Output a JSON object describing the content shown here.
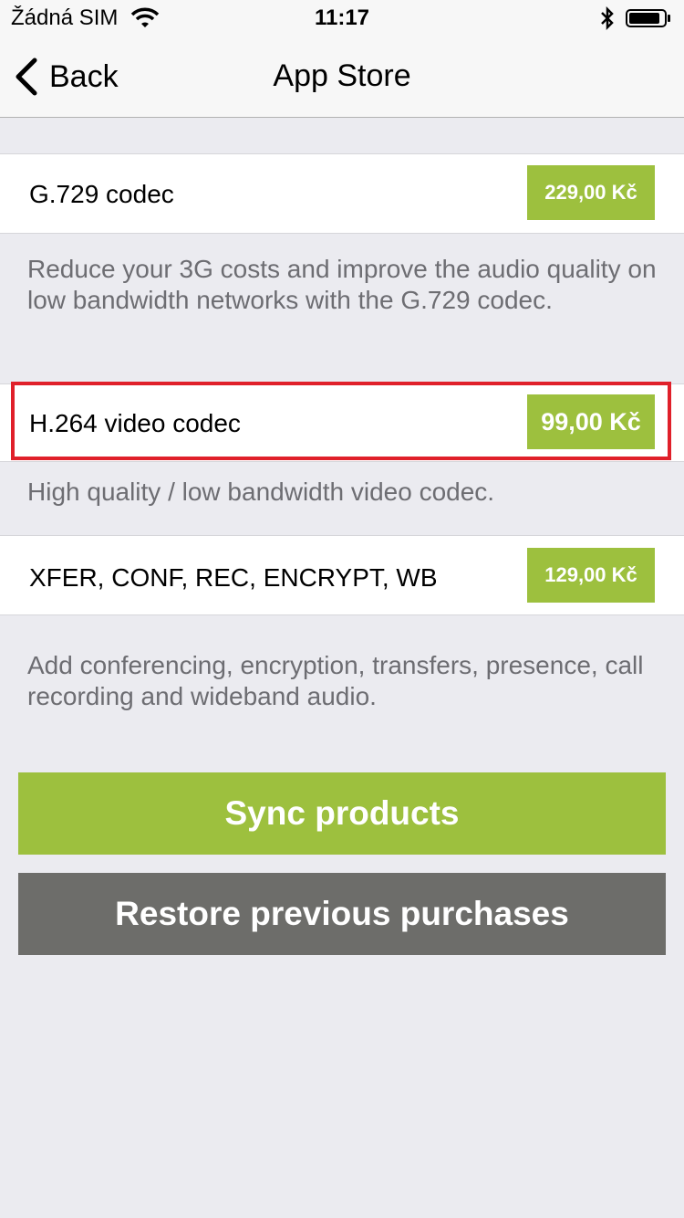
{
  "status_bar": {
    "carrier": "Žádná SIM",
    "time": "11:17",
    "wifi_icon": "wifi-icon",
    "bluetooth_icon": "bluetooth-icon",
    "battery_icon": "battery-icon"
  },
  "nav": {
    "back_label": "Back",
    "back_icon": "chevron-left-icon",
    "title": "App Store"
  },
  "products": [
    {
      "name": "G.729 codec",
      "price": "229,00 Kč",
      "description": "Reduce your 3G costs and improve the audio quality on low bandwidth networks with the G.729 codec."
    },
    {
      "name": "H.264 video codec",
      "price": "99,00 Kč",
      "description": "High quality / low bandwidth video codec."
    },
    {
      "name": "XFER, CONF, REC, ENCRYPT, WB",
      "price": "129,00 Kč",
      "description": "Add conferencing, encryption, transfers, presence, call recording and wideband audio."
    }
  ],
  "buttons": {
    "sync": "Sync products",
    "restore": "Restore previous purchases"
  },
  "colors": {
    "accent_green": "#9dc03e",
    "button_gray": "#6d6d6a",
    "highlight_red": "#e0202a",
    "background": "#ebebf0"
  }
}
